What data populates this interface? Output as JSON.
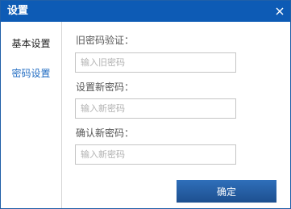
{
  "window": {
    "title": "设置"
  },
  "sidebar": {
    "items": [
      {
        "label": "基本设置"
      },
      {
        "label": "密码设置"
      }
    ]
  },
  "form": {
    "old_password": {
      "label": "旧密码验证：",
      "placeholder": "输入旧密码",
      "value": ""
    },
    "new_password": {
      "label": "设置新密码：",
      "placeholder": "输入新密码",
      "value": ""
    },
    "confirm_password": {
      "label": "确认新密码：",
      "placeholder": "输入新密码",
      "value": ""
    }
  },
  "footer": {
    "ok_label": "确定"
  },
  "colors": {
    "titlebar": "#0d5bb5",
    "selected_item": "#1f6bc2",
    "button": "#2463a8"
  }
}
